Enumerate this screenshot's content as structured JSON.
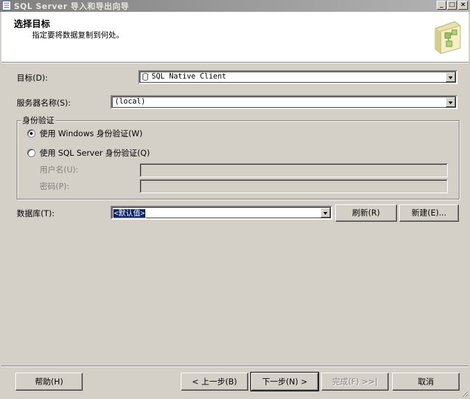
{
  "window": {
    "title": "SQL Server 导入和导出向导",
    "minimize": "_",
    "maximize": "□",
    "close": "×"
  },
  "header": {
    "title": "选择目标",
    "subtitle": "指定要将数据复制到何处。"
  },
  "form": {
    "destination_label": "目标(D):",
    "destination_value": "SQL Native Client",
    "server_label": "服务器名称(S):",
    "server_value": "(local)",
    "auth_group_title": "身份验证",
    "windows_auth_label": "使用 Windows 身份验证(W)",
    "windows_auth_selected": true,
    "sql_auth_label": "使用 SQL Server 身份验证(Q)",
    "username_label": "用户名(U):",
    "password_label": "密码(P):",
    "database_label": "数据库(T):",
    "database_value": "<默认值>",
    "refresh_label": "刷新(R)",
    "new_label": "新建(E)..."
  },
  "footer": {
    "help_label": "帮助(H)",
    "back_label": "< 上一步(B)",
    "next_label": "下一步(N) >",
    "finish_label": "完成(F) >>|",
    "cancel_label": "取消"
  }
}
